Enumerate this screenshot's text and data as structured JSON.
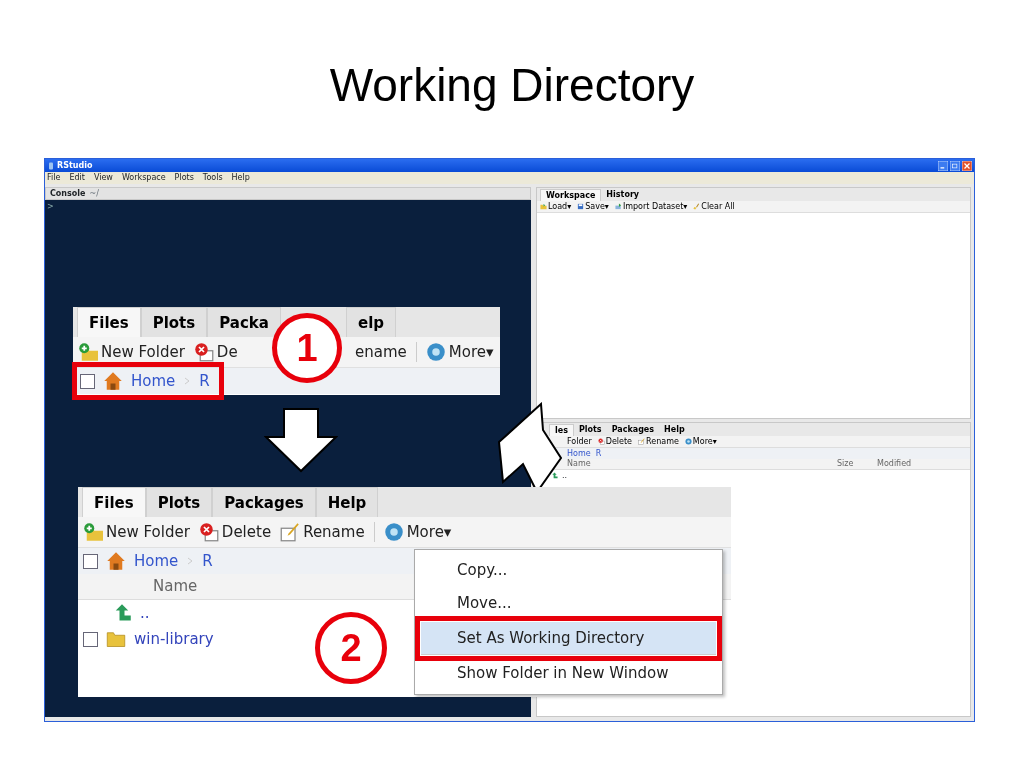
{
  "slide_title": "Working Directory",
  "window": {
    "title": "RStudio",
    "menu": [
      "File",
      "Edit",
      "View",
      "Workspace",
      "Plots",
      "Tools",
      "Help"
    ]
  },
  "console": {
    "title": "Console",
    "path": "~/",
    "prompt": ">"
  },
  "workspace_pane": {
    "tabs": [
      {
        "label": "Workspace",
        "selected": true
      },
      {
        "label": "History",
        "selected": false
      }
    ],
    "toolbar": [
      {
        "label": "Load▾",
        "kind": "load"
      },
      {
        "label": "Save▾",
        "kind": "save"
      },
      {
        "label": "Import Dataset▾",
        "kind": "import"
      },
      {
        "label": "Clear All",
        "kind": "clear"
      }
    ]
  },
  "files_pane": {
    "tabs": [
      {
        "label": "les",
        "selected": true
      },
      {
        "label": "Plots",
        "selected": false
      },
      {
        "label": "Packages",
        "selected": false
      },
      {
        "label": "Help",
        "selected": false
      }
    ],
    "toolbar": [
      {
        "label": "Folder",
        "kind": "none"
      },
      {
        "label": "Delete",
        "kind": "delete"
      },
      {
        "label": "Rename",
        "kind": "rename"
      },
      {
        "label": "More▾",
        "kind": "more"
      }
    ],
    "breadcrumb": [
      "Home",
      "R"
    ],
    "columns": [
      "Name",
      "Size",
      "Modified"
    ],
    "rows": [
      {
        "name": "..",
        "kind": "up"
      }
    ]
  },
  "callout_1": {
    "number": "1",
    "tabs": [
      {
        "label": "Files",
        "selected": true
      },
      {
        "label": "Plots",
        "selected": false
      },
      {
        "label": "Packa",
        "selected": false
      },
      {
        "label": "elp",
        "selected": false
      }
    ],
    "toolbar": [
      {
        "label": "New Folder",
        "kind": "new_folder"
      },
      {
        "label": "De",
        "kind": "delete"
      },
      {
        "label": "ename",
        "kind": "none"
      },
      {
        "label": "More▾",
        "kind": "more"
      }
    ],
    "breadcrumb": {
      "items": [
        "Home",
        "R"
      ],
      "checked": false,
      "highlighted": true
    }
  },
  "callout_2": {
    "number": "2",
    "tabs": [
      {
        "label": "Files",
        "selected": true
      },
      {
        "label": "Plots",
        "selected": false
      },
      {
        "label": "Packages",
        "selected": false
      },
      {
        "label": "Help",
        "selected": false
      }
    ],
    "toolbar": [
      {
        "label": "New Folder",
        "kind": "new_folder"
      },
      {
        "label": "Delete",
        "kind": "delete"
      },
      {
        "label": "Rename",
        "kind": "rename"
      },
      {
        "label": "More▾",
        "kind": "more"
      }
    ],
    "breadcrumb": {
      "items": [
        "Home",
        "R"
      ],
      "checked": false
    },
    "column": "Name",
    "rows": [
      {
        "name": "..",
        "kind": "up"
      },
      {
        "name": "win-library",
        "kind": "folder",
        "checked": false
      }
    ],
    "menu": [
      {
        "label": "Copy...",
        "selected": false,
        "highlighted": false,
        "divider_after": false
      },
      {
        "label": "Move...",
        "selected": false,
        "highlighted": false,
        "divider_after": true
      },
      {
        "label": "Set As Working Directory",
        "selected": true,
        "highlighted": true,
        "divider_after": true
      },
      {
        "label": "Show Folder in New Window",
        "selected": false,
        "highlighted": false,
        "divider_after": false
      }
    ]
  }
}
